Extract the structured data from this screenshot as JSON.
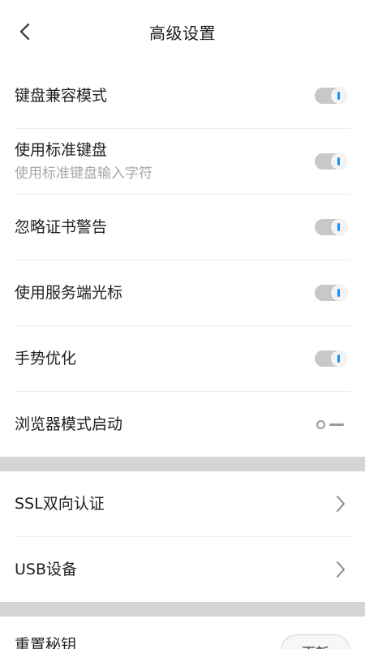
{
  "header": {
    "title": "高级设置",
    "back_icon": "chevron-left-icon"
  },
  "toggles": [
    {
      "label": "键盘兼容模式",
      "state": "on"
    },
    {
      "label": "使用标准键盘",
      "sublabel": "使用标准键盘输入字符",
      "state": "on"
    },
    {
      "label": "忽略证书警告",
      "state": "on"
    },
    {
      "label": "使用服务端光标",
      "state": "on"
    },
    {
      "label": "手势优化",
      "state": "on"
    },
    {
      "label": "浏览器模式启动",
      "state": "off"
    }
  ],
  "links": [
    {
      "label": "SSL双向认证",
      "icon": "chevron-right-icon"
    },
    {
      "label": "USB设备",
      "icon": "chevron-right-icon"
    }
  ],
  "key_row": {
    "label": "重置秘钥",
    "button_label": "更新"
  },
  "colors": {
    "toggle_accent": "#1a8ef0",
    "toggle_track": "#c8c8c8",
    "divider": "#ececec",
    "section_gap": "#d5d5d5",
    "sublabel": "#a8a8a8"
  }
}
